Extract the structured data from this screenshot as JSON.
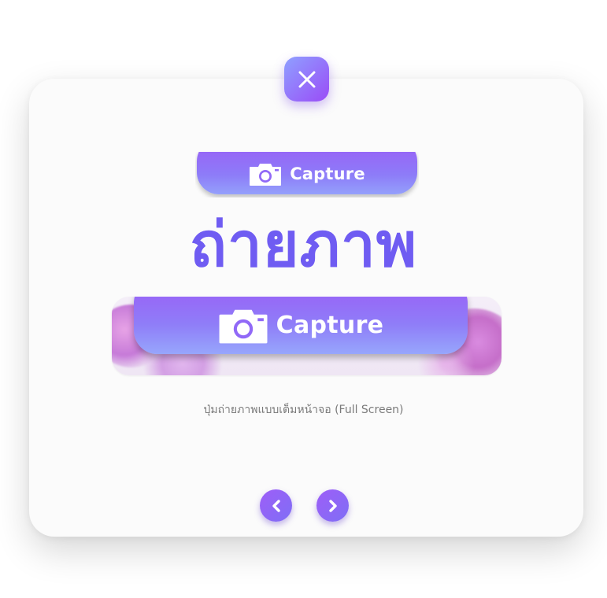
{
  "dialog": {
    "close_icon": "close-icon",
    "accent_gradient": [
      "#8fa0ff",
      "#9a4cf7"
    ]
  },
  "small_button": {
    "icon": "camera-icon",
    "label": "Capture"
  },
  "headline": {
    "text": "ถ่ายภาพ",
    "color": "#6f5cf2"
  },
  "preview": {
    "icon": "camera-icon",
    "label": "Capture"
  },
  "caption": {
    "text": "ปุ่มถ่ายภาพแบบเต็มหน้าจอ (Full Screen)"
  },
  "navigation": {
    "prev_icon": "chevron-left-icon",
    "next_icon": "chevron-right-icon"
  }
}
